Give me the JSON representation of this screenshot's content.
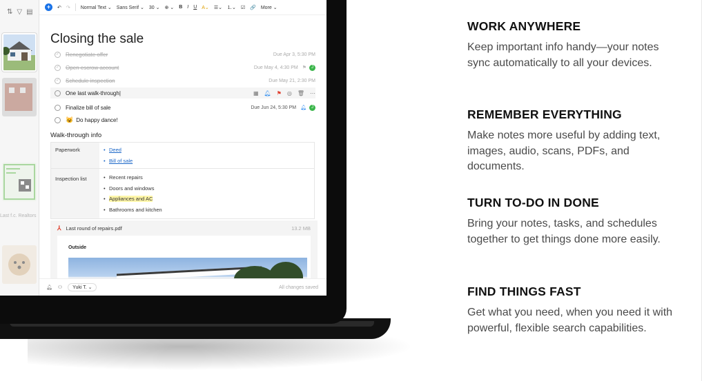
{
  "toolbar": {
    "text_style": "Normal Text ⌄",
    "font": "Sans Serif ⌄",
    "size": "30 ⌄",
    "bold": "B",
    "italic": "I",
    "underline": "U",
    "more": "More ⌄"
  },
  "sidebar": {
    "caption": "Last f.c. Realtors"
  },
  "note": {
    "title": "Closing the sale",
    "tasks": [
      {
        "text": "Renegotiate offer",
        "due": "Due Apr 3, 5:30 PM",
        "done": true
      },
      {
        "text": "Open escrow account",
        "due": "Due May 4, 4:30 PM",
        "done": true,
        "avatar": "J"
      },
      {
        "text": "Schedule inspection",
        "due": "Due May 21, 2:30 PM",
        "done": true
      },
      {
        "text": "One last walk-through",
        "done": false,
        "active": true
      },
      {
        "text": "Finalize bill of sale",
        "due": "Due Jun 24, 5:30 PM",
        "done": false,
        "avatar": "J"
      },
      {
        "text": "Do happy dance!",
        "done": false,
        "emoji": "😺"
      }
    ],
    "section_heading": "Walk-through info",
    "table": {
      "rows": [
        {
          "key": "Paperwork",
          "items": [
            "Deed",
            "Bill of sale"
          ]
        },
        {
          "key": "Inspection list",
          "items": [
            "Recent repairs",
            "Doors and windows",
            "Appliances and AC",
            "Bathrooms and kitchen"
          ]
        }
      ]
    },
    "attachment": {
      "name": "Last round of repairs.pdf",
      "size": "13.2 MB",
      "caption": "Outside"
    }
  },
  "footer": {
    "user": "Yuki T. ⌄",
    "status": "All changes saved"
  },
  "features": [
    {
      "title": "WORK ANYWHERE",
      "body": "Keep important info handy—your notes sync automatically to all your devices."
    },
    {
      "title": "REMEMBER EVERYTHING",
      "body": "Make notes more useful by adding text, images, audio, scans, PDFs, and documents."
    },
    {
      "title": "TURN TO-DO IN DONE",
      "body": "Bring your notes, tasks, and schedules together to get things done more easily."
    },
    {
      "title": "FIND THINGS FAST",
      "body": "Get what you need, when you need it with powerful, flexible search capabilities."
    }
  ],
  "colors": {
    "accent_blue": "#1a73e8",
    "flag_red": "#e03e2d",
    "assignee_green": "#3ab54a",
    "highlight_yellow": "#fff6a8"
  }
}
